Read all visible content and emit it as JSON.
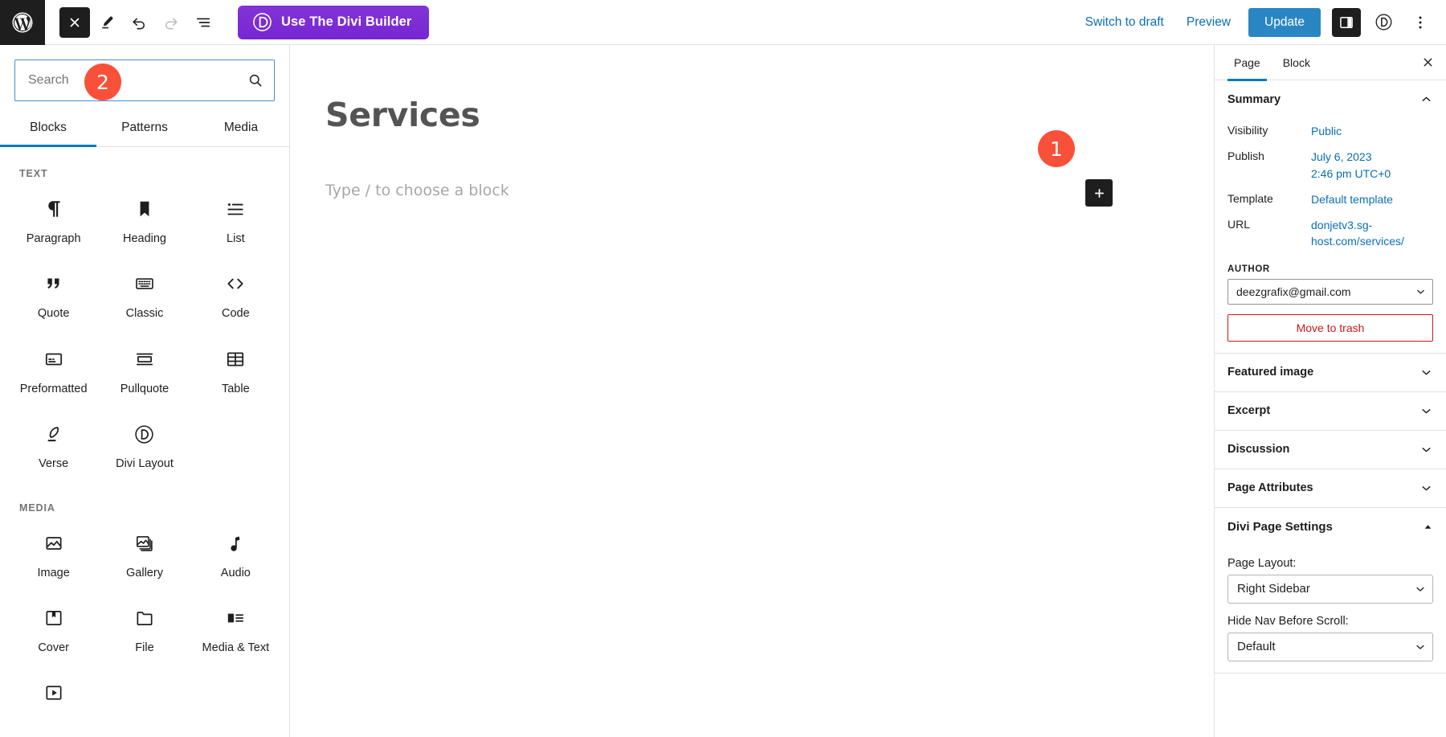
{
  "topbar": {
    "wp_logo_name": "wordpress-logo",
    "close_label": "Close",
    "edit_label": "Edit",
    "undo_label": "Undo",
    "redo_label": "Redo",
    "list_view_label": "Document Overview",
    "divi_button_label": "Use The Divi Builder",
    "divi_button_color": "#7e3bd0",
    "switch_to_draft_label": "Switch to draft",
    "preview_label": "Preview",
    "update_label": "Update",
    "update_color": "#2a86c3",
    "settings_label": "Settings",
    "divi_icon_label": "Divi",
    "options_label": "Options"
  },
  "inserter": {
    "search": {
      "value": "",
      "placeholder": "Search",
      "icon": "search-icon"
    },
    "tabs": [
      {
        "label": "Blocks",
        "active": true
      },
      {
        "label": "Patterns",
        "active": false
      },
      {
        "label": "Media",
        "active": false
      }
    ],
    "sections": [
      {
        "title": "TEXT",
        "blocks": [
          {
            "label": "Paragraph",
            "icon": "paragraph-icon"
          },
          {
            "label": "Heading",
            "icon": "heading-icon"
          },
          {
            "label": "List",
            "icon": "list-icon"
          },
          {
            "label": "Quote",
            "icon": "quote-icon"
          },
          {
            "label": "Classic",
            "icon": "classic-icon"
          },
          {
            "label": "Code",
            "icon": "code-icon"
          },
          {
            "label": "Preformatted",
            "icon": "preformatted-icon"
          },
          {
            "label": "Pullquote",
            "icon": "pullquote-icon"
          },
          {
            "label": "Table",
            "icon": "table-icon"
          },
          {
            "label": "Verse",
            "icon": "verse-icon"
          },
          {
            "label": "Divi Layout",
            "icon": "divi-layout-icon"
          }
        ]
      },
      {
        "title": "MEDIA",
        "blocks": [
          {
            "label": "Image",
            "icon": "image-icon"
          },
          {
            "label": "Gallery",
            "icon": "gallery-icon"
          },
          {
            "label": "Audio",
            "icon": "audio-icon"
          },
          {
            "label": "Cover",
            "icon": "cover-icon"
          },
          {
            "label": "File",
            "icon": "file-icon"
          },
          {
            "label": "Media & Text",
            "icon": "media-text-icon"
          },
          {
            "label": "",
            "icon": "video-icon"
          }
        ]
      }
    ]
  },
  "canvas": {
    "post_title": "Services",
    "block_placeholder": "Type / to choose a block",
    "add_block_label": "+"
  },
  "sidebar": {
    "tabs": [
      {
        "label": "Page",
        "active": true
      },
      {
        "label": "Block",
        "active": false
      }
    ],
    "close_label": "Close settings",
    "summary": {
      "title": "Summary",
      "expanded": true,
      "rows": [
        {
          "label": "Visibility",
          "value": "Public"
        },
        {
          "label": "Publish",
          "value": "July 6, 2023\n2:46 pm UTC+0"
        },
        {
          "label": "Template",
          "value": "Default template"
        },
        {
          "label": "URL",
          "value": "donjetv3.sg-host.com/services/"
        }
      ],
      "author_label": "AUTHOR",
      "author_value": "deezgrafix@gmail.com",
      "trash_label": "Move to trash"
    },
    "panels": [
      {
        "title": "Featured image",
        "expanded": false
      },
      {
        "title": "Excerpt",
        "expanded": false
      },
      {
        "title": "Discussion",
        "expanded": false
      },
      {
        "title": "Page Attributes",
        "expanded": false
      }
    ],
    "divi_panel": {
      "title": "Divi Page Settings",
      "expanded": true,
      "fields": [
        {
          "label": "Page Layout:",
          "value": "Right Sidebar"
        },
        {
          "label": "Hide Nav Before Scroll:",
          "value": "Default"
        }
      ]
    }
  },
  "annotations": [
    {
      "id": "1",
      "number": "1",
      "color": "#f9503a"
    },
    {
      "id": "2",
      "number": "2",
      "color": "#f9503a"
    }
  ]
}
